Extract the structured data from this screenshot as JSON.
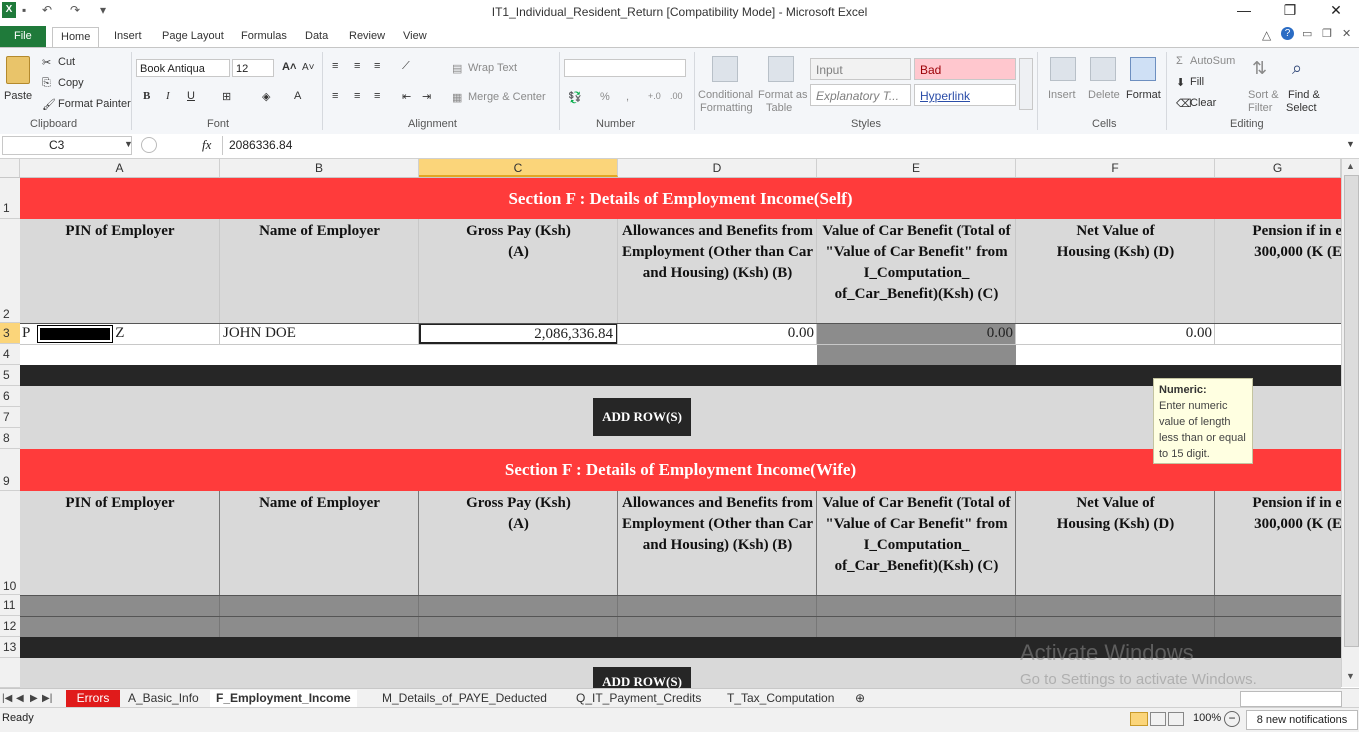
{
  "window": {
    "title": "IT1_Individual_Resident_Return  [Compatibility Mode]  -  Microsoft Excel",
    "minimize": "—",
    "restore": "❐",
    "close": "✕"
  },
  "ribbon_tabs": [
    "File",
    "Home",
    "Insert",
    "Page Layout",
    "Formulas",
    "Data",
    "Review",
    "View"
  ],
  "ribbon": {
    "clipboard": {
      "paste": "Paste",
      "cut": "Cut",
      "copy": "Copy",
      "format_painter": "Format Painter",
      "label": "Clipboard"
    },
    "font": {
      "name": "Book Antiqua",
      "size": "12",
      "label": "Font"
    },
    "alignment": {
      "wrap_text": "Wrap Text",
      "merge_center": "Merge & Center",
      "label": "Alignment"
    },
    "number": {
      "format": "",
      "percent": "%",
      "comma": ",",
      "label": "Number"
    },
    "styles": {
      "conditional": "Conditional",
      "conditional2": "Formatting",
      "format_as": "Format as",
      "format_as2": "Table",
      "input": "Input",
      "bad": "Bad",
      "explanatory": "Explanatory T...",
      "hyperlink": "Hyperlink",
      "label": "Styles"
    },
    "cells": {
      "insert": "Insert",
      "delete": "Delete",
      "format": "Format",
      "label": "Cells"
    },
    "editing": {
      "autosum": "AutoSum",
      "fill": "Fill",
      "clear": "Clear",
      "sort": "Sort &",
      "sort2": "Filter",
      "find": "Find &",
      "find2": "Select",
      "label": "Editing"
    }
  },
  "formula_bar": {
    "name_box": "C3",
    "fx": "fx",
    "value": "2086336.84"
  },
  "columns": [
    "A",
    "B",
    "C",
    "D",
    "E",
    "F",
    "G"
  ],
  "rows": [
    "1",
    "2",
    "3",
    "4",
    "5",
    "6",
    "7",
    "8",
    "9",
    "10",
    "11",
    "12",
    "13"
  ],
  "section_self": {
    "title": "Section F : Details of Employment Income(Self)",
    "headers": [
      "PIN of Employer",
      "Name of Employer",
      "Gross Pay (Ksh) (A)",
      "Allowances and Benefits from Employment (Other than Car and Housing) (Ksh) (B)",
      "Value of Car Benefit (Total of \"Value of Car Benefit\" from I_Computation_ of_Car_Benefit)(Ksh) (C)",
      "Net Value of Housing (Ksh) (D)",
      "Pension if in e: 300,000 (K (E)"
    ],
    "row3": {
      "pin_start": "P",
      "pin_end": "Z",
      "name": "JOHN DOE",
      "gross": "2,086,336.84",
      "allowances": "0.00",
      "car": "0.00",
      "housing": "0.00"
    },
    "add_button": "ADD ROW(S)"
  },
  "section_wife": {
    "title": "Section F : Details of Employment Income(Wife)",
    "headers": [
      "PIN of Employer",
      "Name of Employer",
      "Gross Pay (Ksh) (A)",
      "Allowances and Benefits from Employment (Other than Car and Housing) (Ksh) (B)",
      "Value of Car Benefit (Total of \"Value of Car Benefit\" from I_Computation_ of_Car_Benefit)(Ksh) (C)",
      "Net Value of Housing (Ksh) (D)",
      "Pension if in e: 300,000 (K (E)"
    ],
    "add_button": "ADD ROW(S)"
  },
  "tooltip": {
    "title": "Numeric:",
    "body": "Enter numeric value of length less than or equal to 15 digit."
  },
  "watermark": {
    "line1": "Activate Windows",
    "line2": "Go to Settings to activate Windows."
  },
  "sheet_tabs": [
    "Errors",
    "A_Basic_Info",
    "F_Employment_Income",
    "M_Details_of_PAYE_Deducted",
    "Q_IT_Payment_Credits",
    "T_Tax_Computation"
  ],
  "status": {
    "ready": "Ready",
    "zoom": "100%",
    "notifications": "8 new notifications"
  },
  "colors": {
    "section_red": "#ff3b3b",
    "black_band": "#262626",
    "gray_band": "#d9d9d9",
    "dark_row": "#8c8c8c",
    "selection": "#fbd57a",
    "file_tab": "#1f7a3a"
  }
}
